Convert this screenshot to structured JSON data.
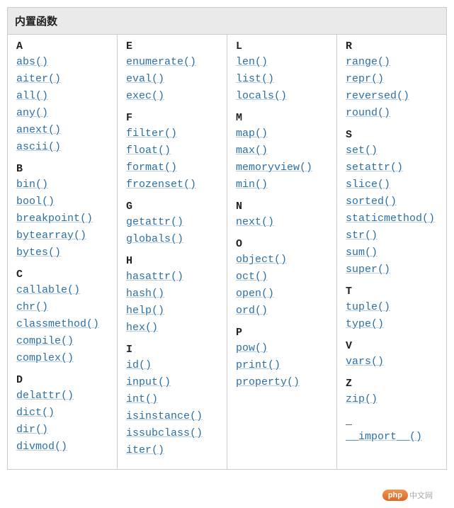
{
  "title": "内置函数",
  "columns": [
    {
      "groups": [
        {
          "letter": "A",
          "fns": [
            "abs()",
            "aiter()",
            "all()",
            "any()",
            "anext()",
            "ascii()"
          ]
        },
        {
          "letter": "B",
          "fns": [
            "bin()",
            "bool()",
            "breakpoint()",
            "bytearray()",
            "bytes()"
          ]
        },
        {
          "letter": "C",
          "fns": [
            "callable()",
            "chr()",
            "classmethod()",
            "compile()",
            "complex()"
          ]
        },
        {
          "letter": "D",
          "fns": [
            "delattr()",
            "dict()",
            "dir()",
            "divmod()"
          ]
        }
      ]
    },
    {
      "groups": [
        {
          "letter": "E",
          "fns": [
            "enumerate()",
            "eval()",
            "exec()"
          ]
        },
        {
          "letter": "F",
          "fns": [
            "filter()",
            "float()",
            "format()",
            "frozenset()"
          ]
        },
        {
          "letter": "G",
          "fns": [
            "getattr()",
            "globals()"
          ]
        },
        {
          "letter": "H",
          "fns": [
            "hasattr()",
            "hash()",
            "help()",
            "hex()"
          ]
        },
        {
          "letter": "I",
          "fns": [
            "id()",
            "input()",
            "int()",
            "isinstance()",
            "issubclass()",
            "iter()"
          ]
        }
      ]
    },
    {
      "groups": [
        {
          "letter": "L",
          "fns": [
            "len()",
            "list()",
            "locals()"
          ]
        },
        {
          "letter": "M",
          "fns": [
            "map()",
            "max()",
            "memoryview()",
            "min()"
          ]
        },
        {
          "letter": "N",
          "fns": [
            "next()"
          ]
        },
        {
          "letter": "O",
          "fns": [
            "object()",
            "oct()",
            "open()",
            "ord()"
          ]
        },
        {
          "letter": "P",
          "fns": [
            "pow()",
            "print()",
            "property()"
          ]
        }
      ]
    },
    {
      "groups": [
        {
          "letter": "R",
          "fns": [
            "range()",
            "repr()",
            "reversed()",
            "round()"
          ]
        },
        {
          "letter": "S",
          "fns": [
            "set()",
            "setattr()",
            "slice()",
            "sorted()",
            "staticmethod()",
            "str()",
            "sum()",
            "super()"
          ]
        },
        {
          "letter": "T",
          "fns": [
            "tuple()",
            "type()"
          ]
        },
        {
          "letter": "V",
          "fns": [
            "vars()"
          ]
        },
        {
          "letter": "Z",
          "fns": [
            "zip()"
          ]
        },
        {
          "letter": "_",
          "fns": [
            "__import__()"
          ]
        }
      ]
    }
  ],
  "watermark": {
    "pill": "php",
    "text": "中文网"
  }
}
